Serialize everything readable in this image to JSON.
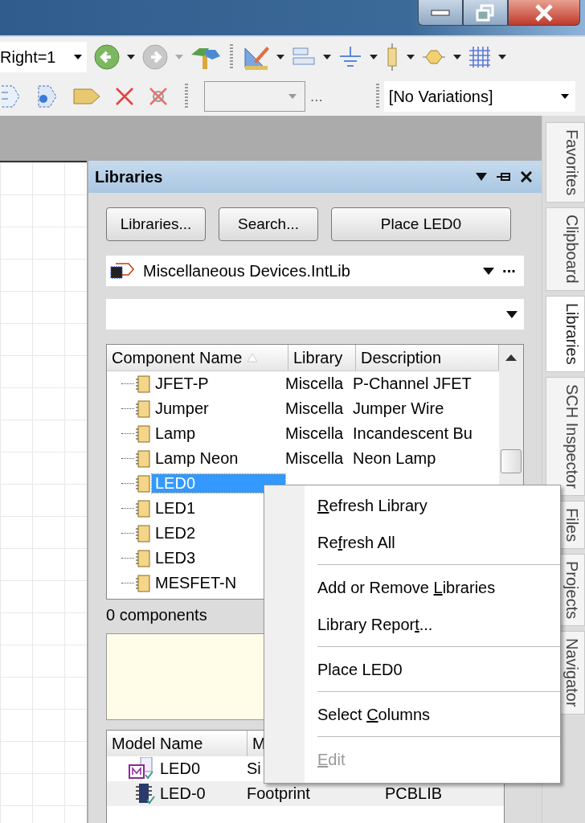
{
  "toolbar": {
    "zoom_combo": "Right=1",
    "variations_combo": "[No Variations]",
    "ellipsis": "..."
  },
  "side_tabs": [
    {
      "label": "Favorites",
      "selected": false
    },
    {
      "label": "Clipboard",
      "selected": false
    },
    {
      "label": "Libraries",
      "selected": true
    },
    {
      "label": "SCH Inspector",
      "selected": false
    },
    {
      "label": "Files",
      "selected": false
    },
    {
      "label": "Projects",
      "selected": false
    },
    {
      "label": "Navigator",
      "selected": false
    }
  ],
  "panel": {
    "title": "Libraries",
    "buttons": [
      "Libraries...",
      "Search...",
      "Place LED0"
    ],
    "library_combo": "Miscellaneous Devices.IntLib",
    "more": "···",
    "columns": [
      "Component Name",
      "Library",
      "Description"
    ],
    "rows": [
      {
        "name": "JFET-P",
        "library": "Miscella",
        "description": "P-Channel JFET",
        "selected": false
      },
      {
        "name": "Jumper",
        "library": "Miscella",
        "description": "Jumper Wire",
        "selected": false
      },
      {
        "name": "Lamp",
        "library": "Miscella",
        "description": "Incandescent Bu",
        "selected": false
      },
      {
        "name": "Lamp Neon",
        "library": "Miscella",
        "description": "Neon Lamp",
        "selected": false
      },
      {
        "name": "LED0",
        "selected": true
      },
      {
        "name": "LED1",
        "selected": false
      },
      {
        "name": "LED2",
        "selected": false
      },
      {
        "name": "LED3",
        "selected": false
      },
      {
        "name": "MESFET-N",
        "selected": false
      }
    ],
    "count": "0 components",
    "model_columns": [
      "Model Name",
      "M"
    ],
    "models": [
      {
        "kind": "sim",
        "name": "LED0",
        "type": "Si",
        "selected": false
      },
      {
        "kind": "footprint",
        "name": "LED-0",
        "type": "Footprint",
        "source": "PCBLIB",
        "selected": true
      }
    ]
  },
  "context_menu": [
    {
      "segments": [
        {
          "text": "R",
          "underlined": true
        },
        {
          "text": "efresh Library",
          "underlined": false
        }
      ],
      "disabled": false,
      "separator_after": false
    },
    {
      "segments": [
        {
          "text": "Re",
          "underlined": false
        },
        {
          "text": "f",
          "underlined": true
        },
        {
          "text": "resh All",
          "underlined": false
        }
      ],
      "disabled": false,
      "separator_after": true
    },
    {
      "segments": [
        {
          "text": "Add or Remove ",
          "underlined": false
        },
        {
          "text": "L",
          "underlined": true
        },
        {
          "text": "ibraries",
          "underlined": false
        }
      ],
      "disabled": false,
      "separator_after": false
    },
    {
      "segments": [
        {
          "text": "Library Repor",
          "underlined": false
        },
        {
          "text": "t",
          "underlined": true
        },
        {
          "text": "...",
          "underlined": false
        }
      ],
      "disabled": false,
      "separator_after": true
    },
    {
      "segments": [
        {
          "text": "Place LED0",
          "underlined": false
        }
      ],
      "disabled": false,
      "separator_after": true
    },
    {
      "segments": [
        {
          "text": "Select ",
          "underlined": false
        },
        {
          "text": "C",
          "underlined": true
        },
        {
          "text": "olumns",
          "underlined": false
        }
      ],
      "disabled": false,
      "separator_after": true
    },
    {
      "segments": [
        {
          "text": "E",
          "underlined": true
        },
        {
          "text": "dit",
          "underlined": false
        }
      ],
      "disabled": true,
      "separator_after": false
    }
  ]
}
